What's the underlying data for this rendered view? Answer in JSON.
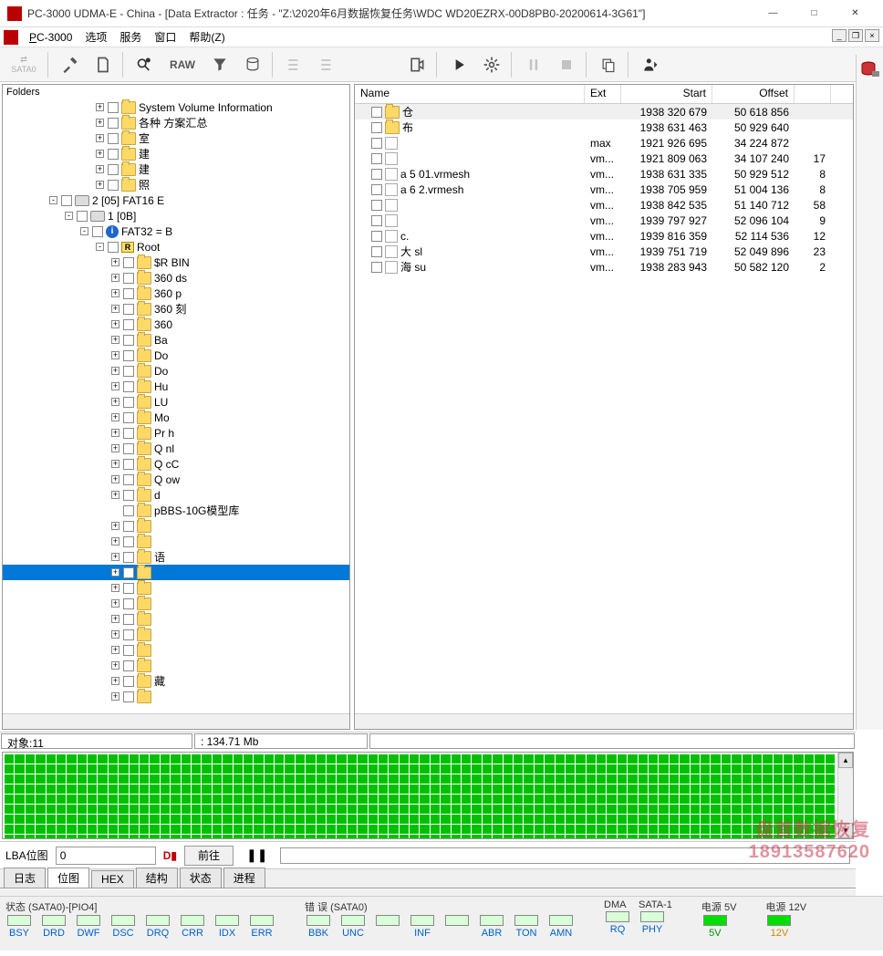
{
  "window": {
    "title": "PC-3000 UDMA-E - China - [Data Extractor : 任务 - \"Z:\\2020年6月数据恢复任务\\WDC WD20EZRX-00D8PB0-20200614-3G61\"]"
  },
  "menu": {
    "app": "PC-3000",
    "items": [
      "选项",
      "服务",
      "窗口",
      "帮助(Z)"
    ]
  },
  "toolbar": {
    "sata": "SATA0",
    "raw": "RAW"
  },
  "folders_label": "Folders",
  "tree": [
    {
      "indent": 6,
      "plus": "+",
      "check": true,
      "folder": true,
      "label": "System Volume Information"
    },
    {
      "indent": 6,
      "plus": "+",
      "check": true,
      "folder": true,
      "label": "各种    方案汇总"
    },
    {
      "indent": 6,
      "plus": "+",
      "check": true,
      "folder": true,
      "label": "室"
    },
    {
      "indent": 6,
      "plus": "+",
      "check": true,
      "folder": true,
      "label": "建"
    },
    {
      "indent": 6,
      "plus": "+",
      "check": true,
      "folder": true,
      "label": "建"
    },
    {
      "indent": 6,
      "plus": "+",
      "check": true,
      "folder": true,
      "label": "照"
    },
    {
      "indent": 3,
      "plus": "-",
      "check": true,
      "drive": true,
      "label": "2 [05] FAT16 E"
    },
    {
      "indent": 4,
      "plus": "-",
      "check": true,
      "drive": true,
      "label": "1 [0B]"
    },
    {
      "indent": 5,
      "plus": "-",
      "check": true,
      "info": true,
      "label": "FAT32 =           B"
    },
    {
      "indent": 6,
      "plus": "-",
      "check": true,
      "root": true,
      "label": "Root"
    },
    {
      "indent": 7,
      "plus": "+",
      "check": true,
      "folder": true,
      "label": "$R            BIN"
    },
    {
      "indent": 7,
      "plus": "+",
      "check": true,
      "folder": true,
      "label": "360         ds"
    },
    {
      "indent": 7,
      "plus": "+",
      "check": true,
      "folder": true,
      "label": "360         p"
    },
    {
      "indent": 7,
      "plus": "+",
      "check": true,
      "folder": true,
      "label": "360                  刻"
    },
    {
      "indent": 7,
      "plus": "+",
      "check": true,
      "folder": true,
      "label": "360"
    },
    {
      "indent": 7,
      "plus": "+",
      "check": true,
      "folder": true,
      "label": "Ba"
    },
    {
      "indent": 7,
      "plus": "+",
      "check": true,
      "folder": true,
      "label": "Do"
    },
    {
      "indent": 7,
      "plus": "+",
      "check": true,
      "folder": true,
      "label": "Do"
    },
    {
      "indent": 7,
      "plus": "+",
      "check": true,
      "folder": true,
      "label": "Hu"
    },
    {
      "indent": 7,
      "plus": "+",
      "check": true,
      "folder": true,
      "label": "LU"
    },
    {
      "indent": 7,
      "plus": "+",
      "check": true,
      "folder": true,
      "label": "Mo"
    },
    {
      "indent": 7,
      "plus": "+",
      "check": true,
      "folder": true,
      "label": "Pr        h"
    },
    {
      "indent": 7,
      "plus": "+",
      "check": true,
      "folder": true,
      "label": "Q         nl"
    },
    {
      "indent": 7,
      "plus": "+",
      "check": true,
      "folder": true,
      "label": "Q         cC"
    },
    {
      "indent": 7,
      "plus": "+",
      "check": true,
      "folder": true,
      "label": "Q         ow"
    },
    {
      "indent": 7,
      "plus": "+",
      "check": true,
      "folder": true,
      "label": "           d"
    },
    {
      "indent": 7,
      "plus": "",
      "check": true,
      "folder": true,
      "label": "       pBBS-10G模型库"
    },
    {
      "indent": 7,
      "plus": "+",
      "check": true,
      "folder": true,
      "label": ""
    },
    {
      "indent": 7,
      "plus": "+",
      "check": true,
      "folder": true,
      "label": ""
    },
    {
      "indent": 7,
      "plus": "+",
      "check": true,
      "folder": true,
      "label": "        语"
    },
    {
      "indent": 7,
      "plus": "+",
      "check": true,
      "folder": true,
      "label": "",
      "selected": true
    },
    {
      "indent": 7,
      "plus": "+",
      "check": true,
      "folder": true,
      "label": ""
    },
    {
      "indent": 7,
      "plus": "+",
      "check": true,
      "folder": true,
      "label": ""
    },
    {
      "indent": 7,
      "plus": "+",
      "check": true,
      "folder": true,
      "label": ""
    },
    {
      "indent": 7,
      "plus": "+",
      "check": true,
      "folder": true,
      "label": ""
    },
    {
      "indent": 7,
      "plus": "+",
      "check": true,
      "folder": true,
      "label": ""
    },
    {
      "indent": 7,
      "plus": "+",
      "check": true,
      "folder": true,
      "label": ""
    },
    {
      "indent": 7,
      "plus": "+",
      "check": true,
      "folder": true,
      "label": "     藏"
    },
    {
      "indent": 7,
      "plus": "+",
      "check": true,
      "folder": true,
      "label": ""
    }
  ],
  "list": {
    "headers": {
      "name": "Name",
      "ext": "Ext",
      "start": "Start",
      "offset": "Offset",
      "blank": ""
    },
    "rows": [
      {
        "name": "仓",
        "ext": "",
        "start": "1938 320 679",
        "offset": "50 618 856",
        "c5": "",
        "folder": true,
        "sel": true
      },
      {
        "name": "布",
        "ext": "",
        "start": "1938 631 463",
        "offset": "50 929 640",
        "c5": "",
        "folder": true
      },
      {
        "name": "",
        "ext": "max",
        "start": "1921 926 695",
        "offset": "34 224 872",
        "c5": "",
        "file": true
      },
      {
        "name": "",
        "ext": "vm...",
        "start": "1921 809 063",
        "offset": "34 107 240",
        "c5": "17",
        "file": true
      },
      {
        "name": "a        5       01.vrmesh",
        "ext": "vm...",
        "start": "1938 631 335",
        "offset": "50 929 512",
        "c5": "8",
        "file": true
      },
      {
        "name": "a        6       2.vrmesh",
        "ext": "vm...",
        "start": "1938 705 959",
        "offset": "51 004 136",
        "c5": "8",
        "file": true
      },
      {
        "name": "",
        "ext": "vm...",
        "start": "1938 842 535",
        "offset": "51 140 712",
        "c5": "58",
        "file": true
      },
      {
        "name": "",
        "ext": "vm...",
        "start": "1939 797 927",
        "offset": "52 096 104",
        "c5": "9",
        "file": true
      },
      {
        "name": "c.",
        "ext": "vm...",
        "start": "1939 816 359",
        "offset": "52 114 536",
        "c5": "12",
        "file": true
      },
      {
        "name": "大        sl",
        "ext": "vm...",
        "start": "1939 751 719",
        "offset": "52 049 896",
        "c5": "23",
        "file": true
      },
      {
        "name": "海        su",
        "ext": "vm...",
        "start": "1938 283 943",
        "offset": "50 582 120",
        "c5": "2",
        "file": true
      }
    ]
  },
  "status": {
    "objects": "对象:11",
    "size": ": 134.71 Mb"
  },
  "lba": {
    "label": "LBA位图",
    "value": "0",
    "go": "前往"
  },
  "tabs": [
    "日志",
    "位图",
    "HEX",
    "结构",
    "状态",
    "进程"
  ],
  "active_tab": 1,
  "status2": {
    "g1_label": "状态 (SATA0)-[PIO4]",
    "g1": [
      "BSY",
      "DRD",
      "DWF",
      "DSC",
      "DRQ",
      "CRR",
      "IDX",
      "ERR"
    ],
    "g2_label": "错 误 (SATA0)",
    "g2": [
      "BBK",
      "UNC",
      "",
      "INF",
      "",
      "ABR",
      "TON",
      "AMN"
    ],
    "g3_label": "DMA",
    "g3": [
      "RQ"
    ],
    "g4_label": "SATA-1",
    "g4": [
      "PHY"
    ],
    "g5_label": "电源 5V",
    "g5": [
      "5V"
    ],
    "g6_label": "电源 12V",
    "g6": [
      "12V"
    ]
  },
  "watermark": {
    "line1": "盘首数据恢复",
    "line2": "18913587620"
  }
}
